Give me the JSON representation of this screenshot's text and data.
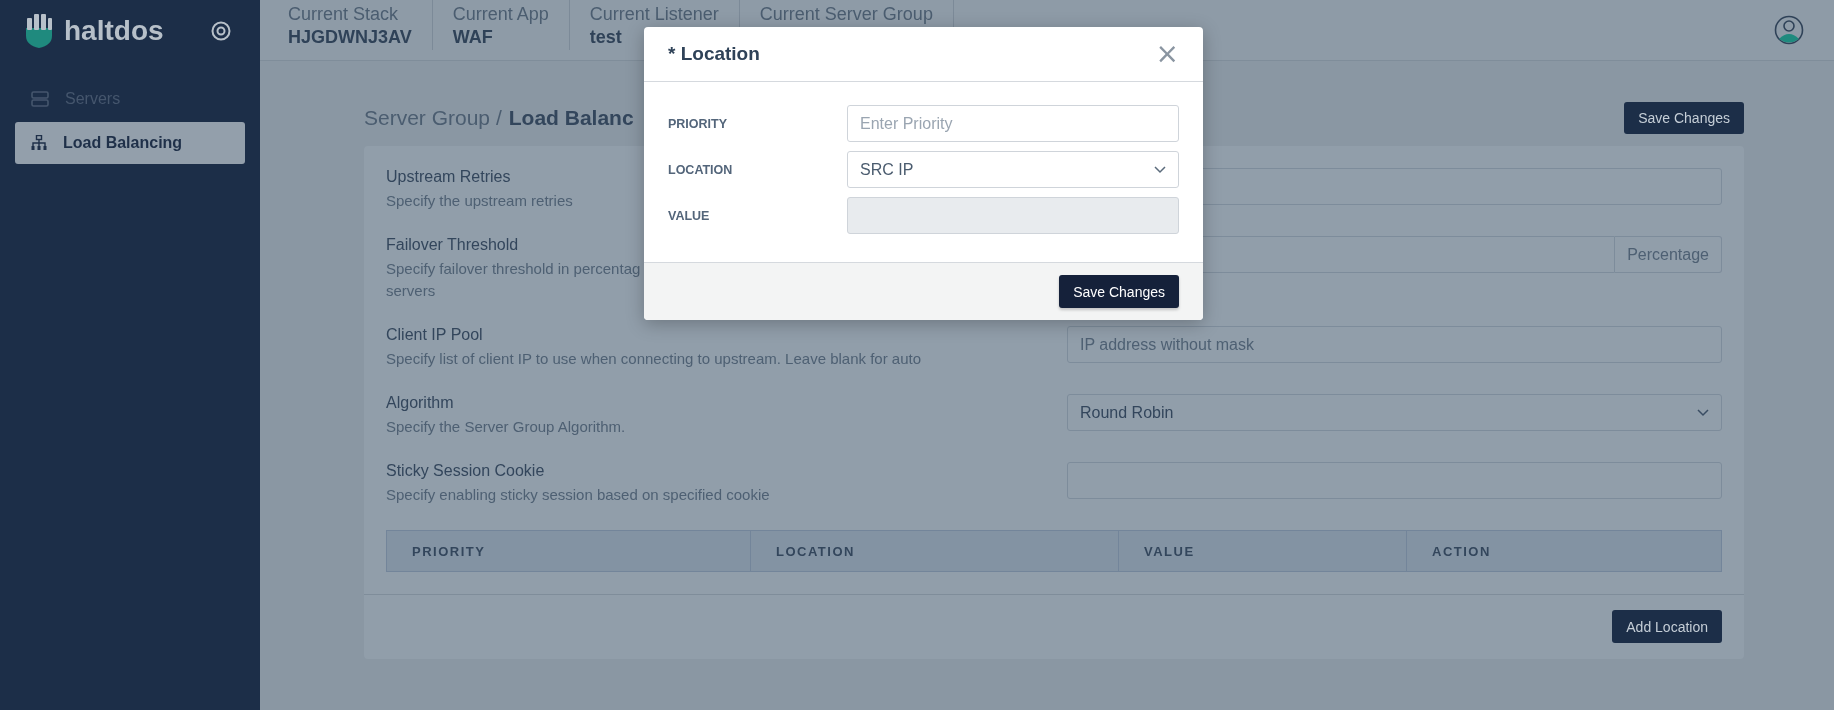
{
  "sidebar": {
    "brand": "haltdos",
    "items": [
      {
        "label": "Servers",
        "selected": false
      },
      {
        "label": "Load Balancing",
        "selected": true
      }
    ]
  },
  "header": {
    "items": [
      {
        "label": "Current Stack",
        "value": "HJGDWNJ3AV"
      },
      {
        "label": "Current App",
        "value": "WAF"
      },
      {
        "label": "Current Listener",
        "value": "test"
      },
      {
        "label": "Current Server Group"
      }
    ]
  },
  "breadcrumb": {
    "parent": "Server Group /",
    "current": "Load Balanc"
  },
  "save_button": "Save Changes",
  "fields": [
    {
      "kind": "input",
      "label": "Upstream Retries",
      "description": "Specify the upstream retries"
    },
    {
      "kind": "addon",
      "label": "Failover Threshold",
      "description": "Specify failover threshold in percentag\nservers",
      "addon": "Percentage"
    },
    {
      "kind": "input",
      "label": "Client IP Pool",
      "description": "Specify list of client IP to use when connecting to upstream. Leave blank for auto",
      "placeholder": "IP address without mask"
    },
    {
      "kind": "select",
      "label": "Algorithm",
      "description": "Specify the Server Group Algorithm.",
      "value": "Round Robin"
    },
    {
      "kind": "input",
      "label": "Sticky Session Cookie",
      "description": "Specify enabling sticky session based on specified cookie"
    }
  ],
  "table": {
    "columns": [
      "PRIORITY",
      "LOCATION",
      "VALUE",
      "ACTION"
    ]
  },
  "add_button": "Add Location",
  "modal": {
    "title": "* Location",
    "close": "×",
    "fields": [
      {
        "kind": "input",
        "label": "PRIORITY",
        "placeholder": "Enter Priority",
        "disabled": false
      },
      {
        "kind": "select",
        "label": "LOCATION",
        "value": "SRC IP",
        "disabled": false
      },
      {
        "kind": "input",
        "label": "VALUE",
        "disabled": true
      }
    ],
    "save_button": "Save Changes"
  }
}
